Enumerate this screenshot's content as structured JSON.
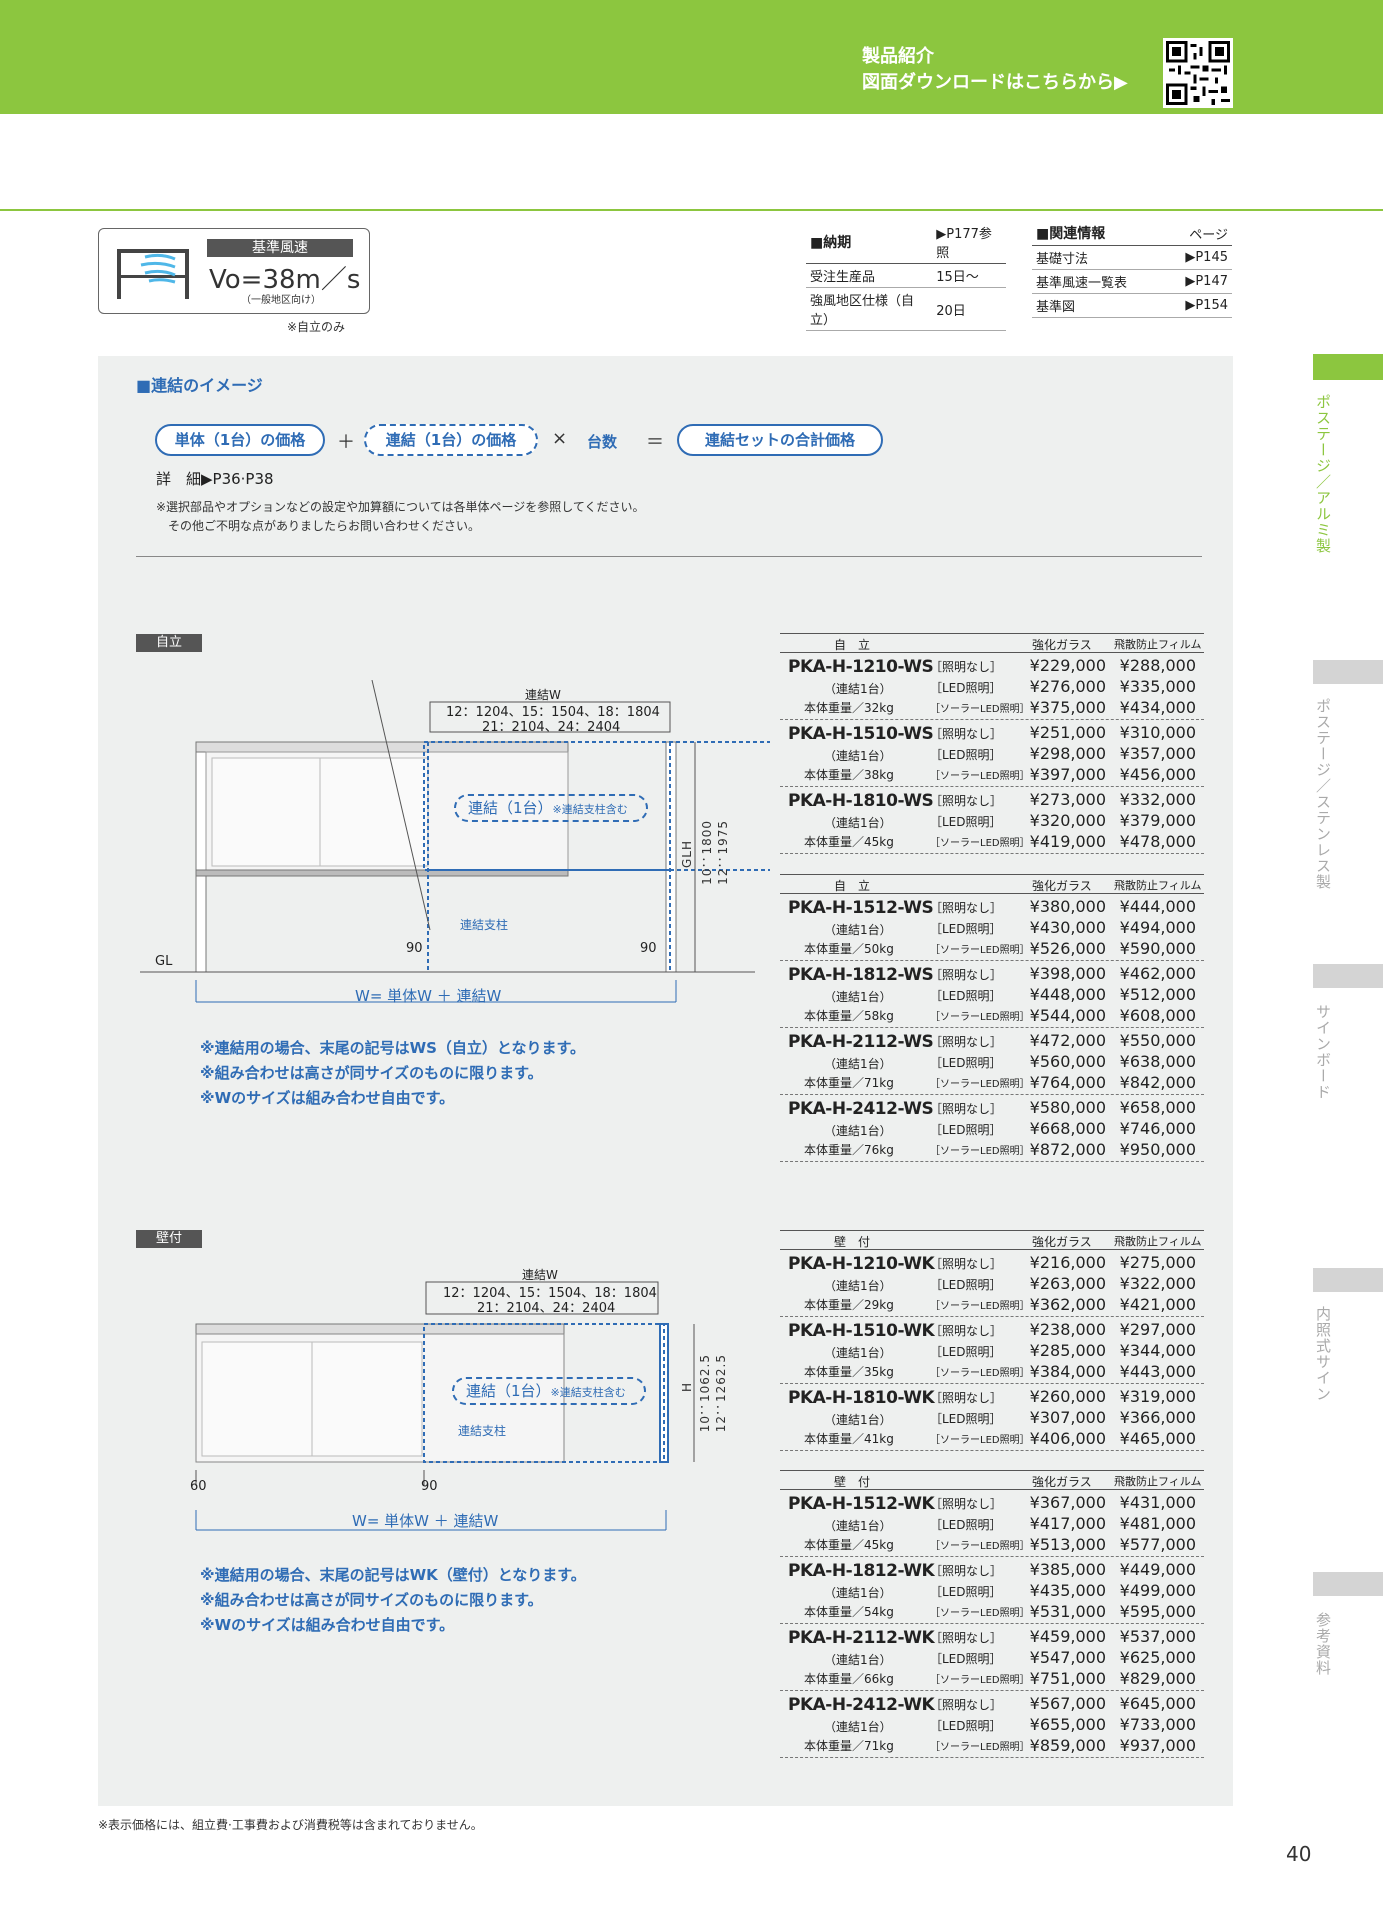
{
  "header": {
    "line1": "製品紹介",
    "line2": "図面ダウンロードはこちらから▶"
  },
  "wind": {
    "label": "基準風速",
    "value": "Vo=38m／s",
    "sub": "（一般地区向け）",
    "note": "※自立のみ"
  },
  "delivery": {
    "title": "■納期",
    "ref": "▶P177参照",
    "rows": [
      [
        "受注生産品",
        "15日～"
      ],
      [
        "強風地区仕様（自立）",
        "20日"
      ]
    ]
  },
  "related": {
    "title": "■関連情報",
    "page_hdr": "ページ",
    "rows": [
      [
        "基礎寸法",
        "▶P145"
      ],
      [
        "基準風速一覧表",
        "▶P147"
      ],
      [
        "基準図",
        "▶P154"
      ]
    ]
  },
  "image_section": {
    "title": "■連結のイメージ",
    "pill1": "単体（1台）の価格",
    "plus": "＋",
    "pill2": "連結（1台）の価格",
    "times": "×",
    "count": "台数",
    "eq": "＝",
    "pill3": "連結セットの合計価格",
    "detail": "詳　細▶P36·P38",
    "note1": "※選択部品やオプションなどの設定や加算額については各単体ページを参照してください。",
    "note2": "その他ご不明な点がありましたらお問い合わせください。"
  },
  "jiritsu": {
    "tag": "自立",
    "dim_title": "連結W",
    "dim1": "12：1204、15：1504、18：1804",
    "dim2": "21：2104、24：2404",
    "box_label": "連結（1台）",
    "box_small": "※連結支柱含む",
    "post": "連結支柱",
    "glh": "GLH",
    "h1": "10：1800",
    "h2": "12：1975",
    "gl": "GL",
    "n90a": "90",
    "n90b": "90",
    "w": "W= 単体W ＋ 連結W",
    "notes": [
      "※連結用の場合、末尾の記号はWS（自立）となります。",
      "※組み合わせは高さが同サイズのものに限ります。",
      "※Wのサイズは組み合わせ自由です。"
    ]
  },
  "kabetsuke": {
    "tag": "壁付",
    "dim_title": "連結W",
    "dim1": "12：1204、15：1504、18：1804",
    "dim2": "21：2104、24：2404",
    "box_label": "連結（1台）",
    "box_small": "※連結支柱含む",
    "post": "連結支柱",
    "hl": "H",
    "h1": "10：1062.5",
    "h2": "12：1262.5",
    "n60": "60",
    "n90": "90",
    "w": "W= 単体W ＋ 連結W",
    "notes": [
      "※連結用の場合、末尾の記号はWK（壁付）となります。",
      "※組み合わせは高さが同サイズのものに限ります。",
      "※Wのサイズは組み合わせ自由です。"
    ]
  },
  "tables": [
    {
      "type": "自　立",
      "c1": "強化ガラス",
      "c2": "飛散防止フィルム",
      "rows": [
        {
          "model": "PKA-H-1210-WS",
          "sub": "（連結1台）",
          "weight": "本体重量／32kg",
          "l": [
            "［照明なし］",
            "［LED照明］",
            "［ソーラーLED照明］"
          ],
          "g": [
            "¥229,000",
            "¥276,000",
            "¥375,000"
          ],
          "f": [
            "¥288,000",
            "¥335,000",
            "¥434,000"
          ]
        },
        {
          "model": "PKA-H-1510-WS",
          "sub": "（連結1台）",
          "weight": "本体重量／38kg",
          "l": [
            "［照明なし］",
            "［LED照明］",
            "［ソーラーLED照明］"
          ],
          "g": [
            "¥251,000",
            "¥298,000",
            "¥397,000"
          ],
          "f": [
            "¥310,000",
            "¥357,000",
            "¥456,000"
          ]
        },
        {
          "model": "PKA-H-1810-WS",
          "sub": "（連結1台）",
          "weight": "本体重量／45kg",
          "l": [
            "［照明なし］",
            "［LED照明］",
            "［ソーラーLED照明］"
          ],
          "g": [
            "¥273,000",
            "¥320,000",
            "¥419,000"
          ],
          "f": [
            "¥332,000",
            "¥379,000",
            "¥478,000"
          ]
        }
      ]
    },
    {
      "type": "自　立",
      "c1": "強化ガラス",
      "c2": "飛散防止フィルム",
      "rows": [
        {
          "model": "PKA-H-1512-WS",
          "sub": "（連結1台）",
          "weight": "本体重量／50kg",
          "l": [
            "［照明なし］",
            "［LED照明］",
            "［ソーラーLED照明］"
          ],
          "g": [
            "¥380,000",
            "¥430,000",
            "¥526,000"
          ],
          "f": [
            "¥444,000",
            "¥494,000",
            "¥590,000"
          ]
        },
        {
          "model": "PKA-H-1812-WS",
          "sub": "（連結1台）",
          "weight": "本体重量／58kg",
          "l": [
            "［照明なし］",
            "［LED照明］",
            "［ソーラーLED照明］"
          ],
          "g": [
            "¥398,000",
            "¥448,000",
            "¥544,000"
          ],
          "f": [
            "¥462,000",
            "¥512,000",
            "¥608,000"
          ]
        },
        {
          "model": "PKA-H-2112-WS",
          "sub": "（連結1台）",
          "weight": "本体重量／71kg",
          "l": [
            "［照明なし］",
            "［LED照明］",
            "［ソーラーLED照明］"
          ],
          "g": [
            "¥472,000",
            "¥560,000",
            "¥764,000"
          ],
          "f": [
            "¥550,000",
            "¥638,000",
            "¥842,000"
          ]
        },
        {
          "model": "PKA-H-2412-WS",
          "sub": "（連結1台）",
          "weight": "本体重量／76kg",
          "l": [
            "［照明なし］",
            "［LED照明］",
            "［ソーラーLED照明］"
          ],
          "g": [
            "¥580,000",
            "¥668,000",
            "¥872,000"
          ],
          "f": [
            "¥658,000",
            "¥746,000",
            "¥950,000"
          ]
        }
      ]
    },
    {
      "type": "壁　付",
      "c1": "強化ガラス",
      "c2": "飛散防止フィルム",
      "rows": [
        {
          "model": "PKA-H-1210-WK",
          "sub": "（連結1台）",
          "weight": "本体重量／29kg",
          "l": [
            "［照明なし］",
            "［LED照明］",
            "［ソーラーLED照明］"
          ],
          "g": [
            "¥216,000",
            "¥263,000",
            "¥362,000"
          ],
          "f": [
            "¥275,000",
            "¥322,000",
            "¥421,000"
          ]
        },
        {
          "model": "PKA-H-1510-WK",
          "sub": "（連結1台）",
          "weight": "本体重量／35kg",
          "l": [
            "［照明なし］",
            "［LED照明］",
            "［ソーラーLED照明］"
          ],
          "g": [
            "¥238,000",
            "¥285,000",
            "¥384,000"
          ],
          "f": [
            "¥297,000",
            "¥344,000",
            "¥443,000"
          ]
        },
        {
          "model": "PKA-H-1810-WK",
          "sub": "（連結1台）",
          "weight": "本体重量／41kg",
          "l": [
            "［照明なし］",
            "［LED照明］",
            "［ソーラーLED照明］"
          ],
          "g": [
            "¥260,000",
            "¥307,000",
            "¥406,000"
          ],
          "f": [
            "¥319,000",
            "¥366,000",
            "¥465,000"
          ]
        }
      ]
    },
    {
      "type": "壁　付",
      "c1": "強化ガラス",
      "c2": "飛散防止フィルム",
      "rows": [
        {
          "model": "PKA-H-1512-WK",
          "sub": "（連結1台）",
          "weight": "本体重量／45kg",
          "l": [
            "［照明なし］",
            "［LED照明］",
            "［ソーラーLED照明］"
          ],
          "g": [
            "¥367,000",
            "¥417,000",
            "¥513,000"
          ],
          "f": [
            "¥431,000",
            "¥481,000",
            "¥577,000"
          ]
        },
        {
          "model": "PKA-H-1812-WK",
          "sub": "（連結1台）",
          "weight": "本体重量／54kg",
          "l": [
            "［照明なし］",
            "［LED照明］",
            "［ソーラーLED照明］"
          ],
          "g": [
            "¥385,000",
            "¥435,000",
            "¥531,000"
          ],
          "f": [
            "¥449,000",
            "¥499,000",
            "¥595,000"
          ]
        },
        {
          "model": "PKA-H-2112-WK",
          "sub": "（連結1台）",
          "weight": "本体重量／66kg",
          "l": [
            "［照明なし］",
            "［LED照明］",
            "［ソーラーLED照明］"
          ],
          "g": [
            "¥459,000",
            "¥547,000",
            "¥751,000"
          ],
          "f": [
            "¥537,000",
            "¥625,000",
            "¥829,000"
          ]
        },
        {
          "model": "PKA-H-2412-WK",
          "sub": "（連結1台）",
          "weight": "本体重量／71kg",
          "l": [
            "［照明なし］",
            "［LED照明］",
            "［ソーラーLED照明］"
          ],
          "g": [
            "¥567,000",
            "¥655,000",
            "¥859,000"
          ],
          "f": [
            "¥645,000",
            "¥733,000",
            "¥937,000"
          ]
        }
      ]
    }
  ],
  "sidebar": {
    "s1": "ポステージ／アルミ製",
    "s2": "ポステージ／ステンレス製",
    "s3": "サインボード",
    "s4": "内照式サイン",
    "s5": "参考資料"
  },
  "footer": {
    "note": "※表示価格には、組立費·工事費および消費税等は含まれておりません。",
    "page": "40"
  },
  "colors": {
    "green": "#8cc63f",
    "blue": "#2f6cb5"
  }
}
